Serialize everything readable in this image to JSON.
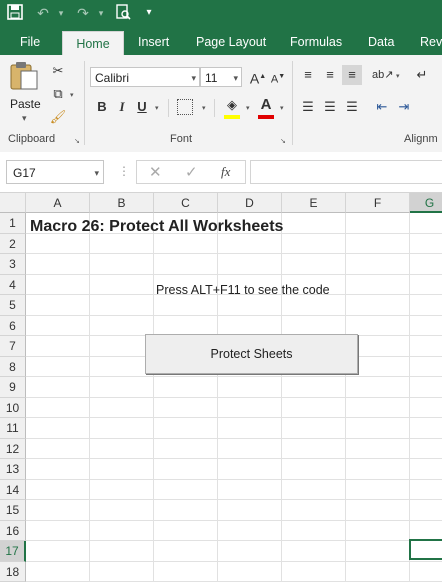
{
  "qat": {
    "save_icon": "save-icon",
    "undo_icon": "undo-icon",
    "redo_icon": "redo-icon",
    "preview_icon": "print-preview-icon"
  },
  "tabs": [
    {
      "label": "File"
    },
    {
      "label": "Home"
    },
    {
      "label": "Insert"
    },
    {
      "label": "Page Layout"
    },
    {
      "label": "Formulas"
    },
    {
      "label": "Data"
    },
    {
      "label": "Revi"
    }
  ],
  "ribbon": {
    "paste_label": "Paste",
    "clipboard_label": "Clipboard",
    "font_name": "Calibri",
    "font_size": "11",
    "font_label": "Font",
    "alignment_label": "Alignm",
    "bold": "B",
    "italic": "I",
    "underline": "U",
    "font_color_letter": "A"
  },
  "formula_bar": {
    "name_box": "G17",
    "fx": "fx",
    "value": ""
  },
  "columns": [
    "A",
    "B",
    "C",
    "D",
    "E",
    "F",
    "G"
  ],
  "rows": [
    "1",
    "2",
    "3",
    "4",
    "5",
    "6",
    "7",
    "8",
    "9",
    "10",
    "11",
    "12",
    "13",
    "14",
    "15",
    "16",
    "17",
    "18"
  ],
  "cells": {
    "a1": "Macro 26: Protect All Worksheets",
    "c4": "Press ALT+F11 to see the code"
  },
  "button": {
    "label": "Protect Sheets"
  },
  "colors": {
    "accent": "#217346",
    "highlight": "#ffff00",
    "font_color": "#e00000"
  }
}
